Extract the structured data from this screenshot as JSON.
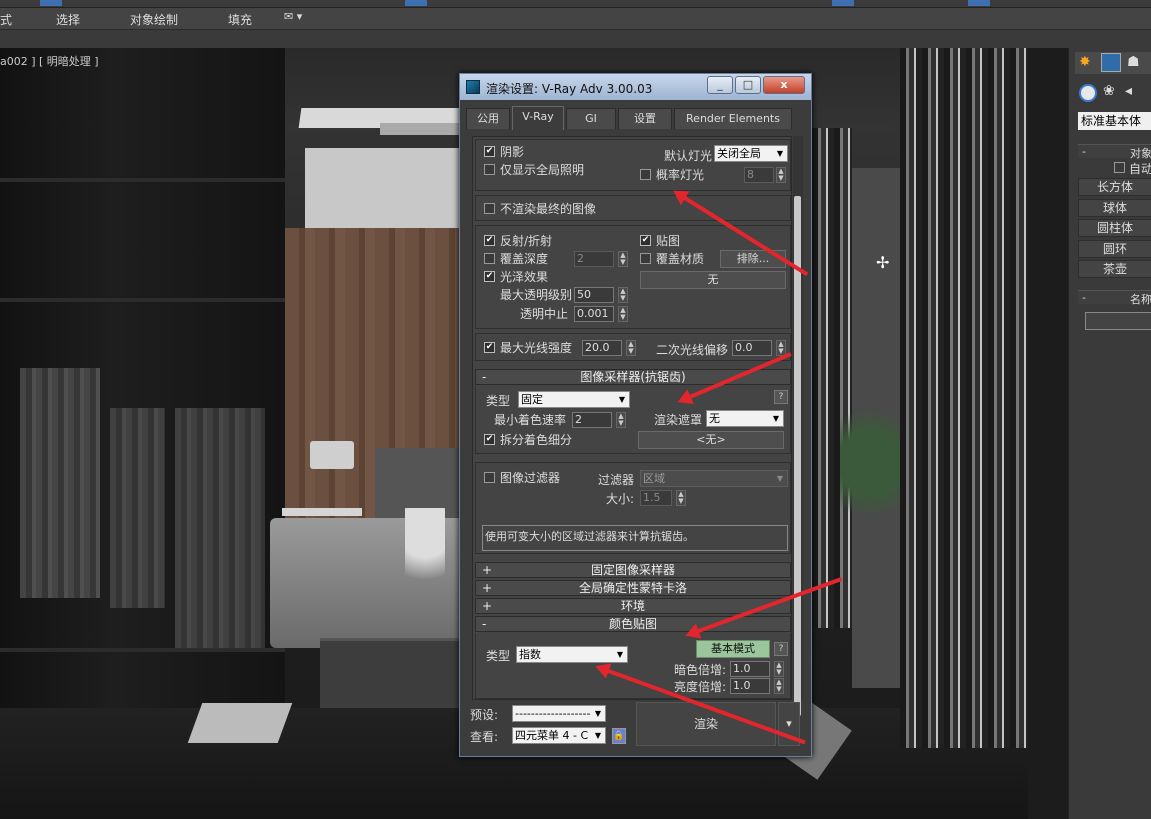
{
  "menu": {
    "items": [
      "式",
      "选择",
      "对象绘制",
      "填充"
    ],
    "extra_icon": "envelope-dropdown-icon"
  },
  "viewport": {
    "label": "a002 ] [ 明暗处理 ]"
  },
  "right_panel": {
    "category": "标准基本体",
    "object_type_header": "对象",
    "auto_grid": "自动",
    "buttons": [
      "长方体",
      "球体",
      "圆柱体",
      "圆环",
      "茶壶"
    ],
    "name_header": "名称"
  },
  "dialog": {
    "title": "渲染设置: V-Ray Adv 3.00.03",
    "min_label": "_",
    "max_label": "□",
    "close_label": "x",
    "tabs": [
      {
        "label": "公用",
        "active": false
      },
      {
        "label": "V-Ray",
        "active": true
      },
      {
        "label": "GI",
        "active": false
      },
      {
        "label": "设置",
        "active": false
      },
      {
        "label": "Render Elements",
        "active": false
      }
    ],
    "global": {
      "shadows": "阴影",
      "gi_only": "仅显示全局照明",
      "default_lights_label": "默认灯光",
      "default_lights_value": "关闭全局",
      "prob_lights": "概率灯光",
      "prob_lights_value": "8",
      "dont_render_final": "不渲染最终的图像",
      "reflect_refract": "反射/折射",
      "override_depth": "覆盖深度",
      "override_depth_value": "2",
      "maps": "贴图",
      "override_mtl": "覆盖材质",
      "exclude_btn": "排除...",
      "none_btn": "无",
      "glossy": "光泽效果",
      "max_transp_label": "最大透明级别",
      "max_transp_value": "50",
      "transp_cutoff_label": "透明中止",
      "transp_cutoff_value": "0.001",
      "max_ray_intensity": "最大光线强度",
      "max_ray_value": "20.0",
      "secondary_bias_label": "二次光线偏移",
      "secondary_bias_value": "0.0"
    },
    "image_sampler": {
      "header": "图像采样器(抗锯齿)",
      "collapse": "-",
      "type_label": "类型",
      "type_value": "固定",
      "min_shading_label": "最小着色速率",
      "min_shading_value": "2",
      "render_mask_label": "渲染遮罩",
      "render_mask_value": "无",
      "mask_none_btn": "<无>",
      "divide_shading": "拆分着色细分",
      "help": "?"
    },
    "image_filter": {
      "label": "图像过滤器",
      "filter_label": "过滤器",
      "filter_value": "区域",
      "size_label": "大小:",
      "size_value": "1.5",
      "description": "使用可变大小的区域过滤器来计算抗锯齿。"
    },
    "rollouts": [
      {
        "sign": "+",
        "label": "固定图像采样器"
      },
      {
        "sign": "+",
        "label": "全局确定性蒙特卡洛"
      },
      {
        "sign": "+",
        "label": "环境"
      }
    ],
    "color_mapping": {
      "header": "颜色贴图",
      "collapse": "-",
      "type_label": "类型",
      "type_value": "指数",
      "mode_btn": "基本模式",
      "help": "?",
      "dark_label": "暗色倍增:",
      "dark_value": "1.0",
      "bright_label": "亮度倍增:",
      "bright_value": "1.0"
    },
    "footer": {
      "preset_label": "预设:",
      "preset_value": "--------------------",
      "view_label": "查看:",
      "view_value": "四元菜单 4 - C",
      "render_btn": "渲染"
    }
  },
  "colors": {
    "annotation_arrow": "#e3262d",
    "titlebar": "#9db4d2"
  }
}
